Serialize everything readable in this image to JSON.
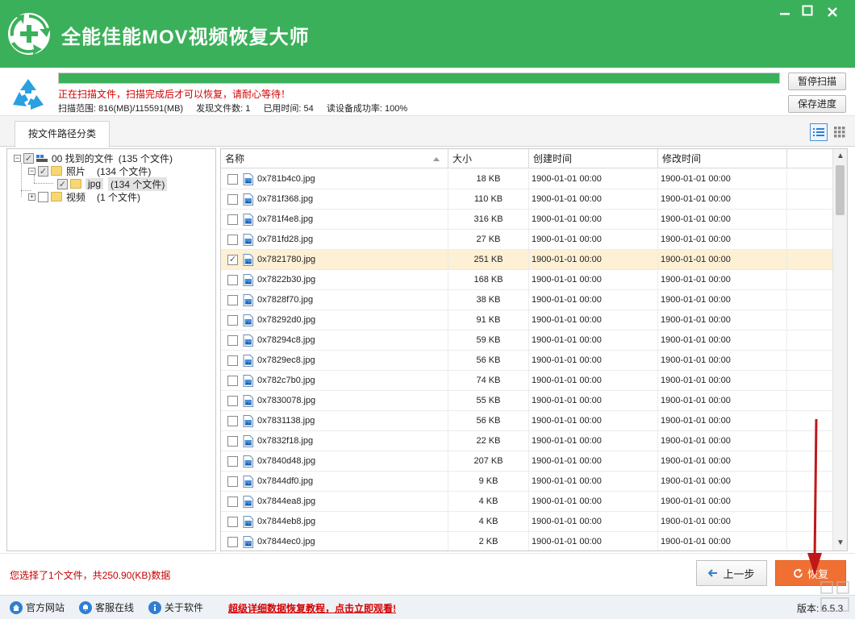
{
  "window": {
    "title": "全能佳能MOV视频恢复大师",
    "brand_color": "#3bb05a",
    "buttons": [
      "minimize-icon",
      "maximize-icon",
      "close-icon"
    ]
  },
  "scan": {
    "progress_fraction": 1.0,
    "status": "正在扫描文件，扫描完成后才可以恢复，请耐心等待！",
    "range": "扫描范围: 816(MB)/115591(MB)",
    "found": "发现文件数: 1",
    "elapsed": "已用时间: 54",
    "read_rate": "读设备成功率: 100%",
    "pause_label": "暂停扫描",
    "save_label": "保存进度"
  },
  "tabs": {
    "by_path": "按文件路径分类"
  },
  "tree": {
    "root_label": "00 找到的文件",
    "root_count": "(135 个文件)",
    "photos_label": "照片",
    "photos_count": "(134 个文件)",
    "jpg_label": "jpg",
    "jpg_count": "(134 个文件)",
    "video_label": "视频",
    "video_count": "(1 个文件)"
  },
  "table": {
    "headers": {
      "name": "名称",
      "size": "大小",
      "created": "创建时间",
      "modified": "修改时间"
    },
    "rows": [
      {
        "name": "0x781b4c0.jpg",
        "size": "18 KB",
        "created": "1900-01-01  00:00",
        "modified": "1900-01-01  00:00",
        "checked": false
      },
      {
        "name": "0x781f368.jpg",
        "size": "110 KB",
        "created": "1900-01-01  00:00",
        "modified": "1900-01-01  00:00",
        "checked": false
      },
      {
        "name": "0x781f4e8.jpg",
        "size": "316 KB",
        "created": "1900-01-01  00:00",
        "modified": "1900-01-01  00:00",
        "checked": false
      },
      {
        "name": "0x781fd28.jpg",
        "size": "27 KB",
        "created": "1900-01-01  00:00",
        "modified": "1900-01-01  00:00",
        "checked": false
      },
      {
        "name": "0x7821780.jpg",
        "size": "251 KB",
        "created": "1900-01-01  00:00",
        "modified": "1900-01-01  00:00",
        "checked": true
      },
      {
        "name": "0x7822b30.jpg",
        "size": "168 KB",
        "created": "1900-01-01  00:00",
        "modified": "1900-01-01  00:00",
        "checked": false
      },
      {
        "name": "0x7828f70.jpg",
        "size": "38 KB",
        "created": "1900-01-01  00:00",
        "modified": "1900-01-01  00:00",
        "checked": false
      },
      {
        "name": "0x78292d0.jpg",
        "size": "91 KB",
        "created": "1900-01-01  00:00",
        "modified": "1900-01-01  00:00",
        "checked": false
      },
      {
        "name": "0x78294c8.jpg",
        "size": "59 KB",
        "created": "1900-01-01  00:00",
        "modified": "1900-01-01  00:00",
        "checked": false
      },
      {
        "name": "0x7829ec8.jpg",
        "size": "56 KB",
        "created": "1900-01-01  00:00",
        "modified": "1900-01-01  00:00",
        "checked": false
      },
      {
        "name": "0x782c7b0.jpg",
        "size": "74 KB",
        "created": "1900-01-01  00:00",
        "modified": "1900-01-01  00:00",
        "checked": false
      },
      {
        "name": "0x7830078.jpg",
        "size": "55 KB",
        "created": "1900-01-01  00:00",
        "modified": "1900-01-01  00:00",
        "checked": false
      },
      {
        "name": "0x7831138.jpg",
        "size": "56 KB",
        "created": "1900-01-01  00:00",
        "modified": "1900-01-01  00:00",
        "checked": false
      },
      {
        "name": "0x7832f18.jpg",
        "size": "22 KB",
        "created": "1900-01-01  00:00",
        "modified": "1900-01-01  00:00",
        "checked": false
      },
      {
        "name": "0x7840d48.jpg",
        "size": "207 KB",
        "created": "1900-01-01  00:00",
        "modified": "1900-01-01  00:00",
        "checked": false
      },
      {
        "name": "0x7844df0.jpg",
        "size": "9 KB",
        "created": "1900-01-01  00:00",
        "modified": "1900-01-01  00:00",
        "checked": false
      },
      {
        "name": "0x7844ea8.jpg",
        "size": "4 KB",
        "created": "1900-01-01  00:00",
        "modified": "1900-01-01  00:00",
        "checked": false
      },
      {
        "name": "0x7844eb8.jpg",
        "size": "4 KB",
        "created": "1900-01-01  00:00",
        "modified": "1900-01-01  00:00",
        "checked": false
      },
      {
        "name": "0x7844ec0.jpg",
        "size": "2 KB",
        "created": "1900-01-01  00:00",
        "modified": "1900-01-01  00:00",
        "checked": false
      }
    ]
  },
  "bottom": {
    "selection_info": "您选择了1个文件，共250.90(KB)数据",
    "prev_label": "上一步",
    "recover_label": "恢复",
    "recover_color": "#f07033"
  },
  "footer": {
    "website": "官方网站",
    "support": "客服在线",
    "about": "关于软件",
    "tutorial": "超级详细数据恢复教程，点击立即观看!",
    "version": "版本: 6.5.3"
  }
}
